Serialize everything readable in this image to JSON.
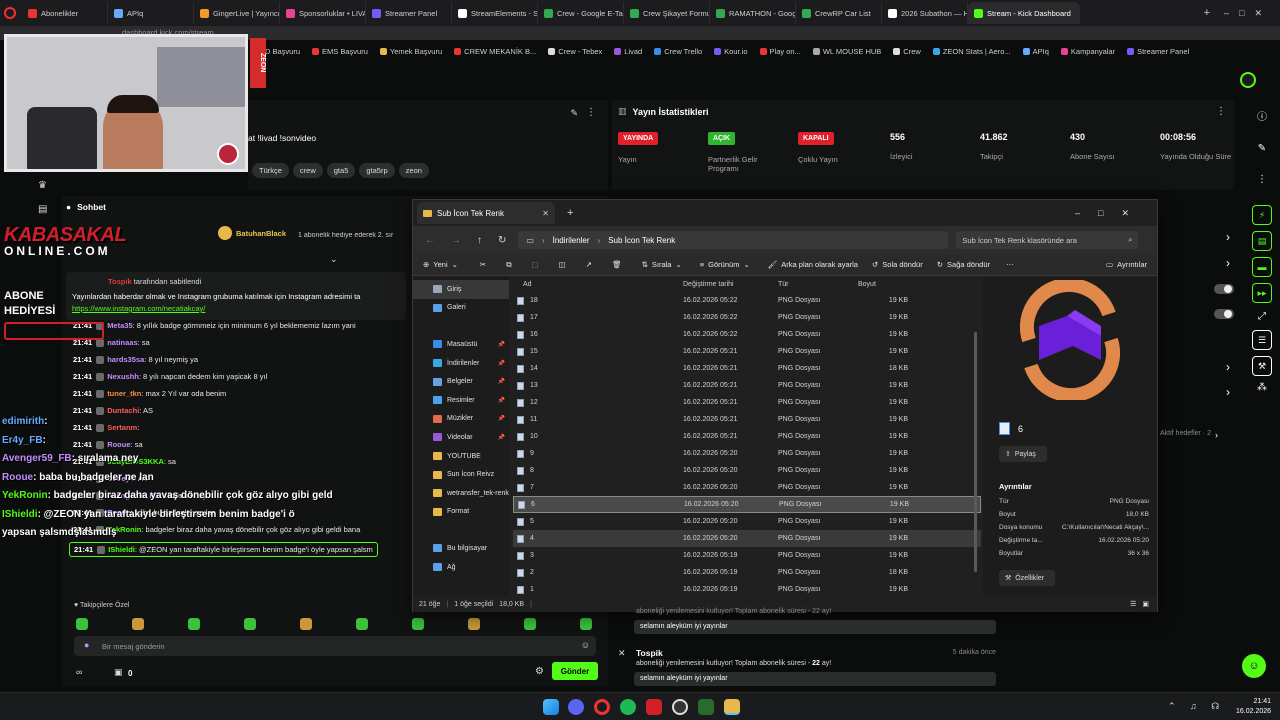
{
  "browser": {
    "tabs": [
      {
        "label": "Abonelikler",
        "color": "#e33"
      },
      {
        "label": "APIq",
        "color": "#66aaff"
      },
      {
        "label": "GingerLive | Yayıncı",
        "color": "#f59b2b"
      },
      {
        "label": "Sponsorluklar • LIVA",
        "color": "#e84393"
      },
      {
        "label": "Streamer Panel",
        "color": "#7a5af5"
      },
      {
        "label": "StreamElements - S",
        "color": "#ffffff"
      },
      {
        "label": "Crew - Google E-Ta",
        "color": "#34a853"
      },
      {
        "label": "Crew Şikayet Formu",
        "color": "#34a853"
      },
      {
        "label": "RAMATHON - Goog",
        "color": "#34a853"
      },
      {
        "label": "CrewRP Car List",
        "color": "#34a853"
      },
      {
        "label": "2026 Subathon — H",
        "color": "#ffffff"
      },
      {
        "label": "Stream - Kick Dashboard",
        "color": "#53fc18"
      }
    ],
    "address": "dashboard.kick.com/stream",
    "bookmarks": [
      "PD Başvuru",
      "EMS Başvuru",
      "Yemek Başvuru",
      "CREW MEKANİK B...",
      "Crew - Tebex",
      "Livad",
      "Crew Trello",
      "Kour.io",
      "Play on...",
      "WL MOUSE HUB",
      "Crew",
      "ZEON Stats | Aero...",
      "APIq",
      "Kampanyalar",
      "Streamer Panel"
    ]
  },
  "stream": {
    "title_partial": "at !livad !sonvideo",
    "tags": [
      "Türkçe",
      "crew",
      "gta5",
      "gta5rp",
      "zeon"
    ],
    "zeon_badge": "ZEON"
  },
  "stats": {
    "heading": "Yayın İstatistikleri",
    "items": [
      {
        "badge": "YAYINDA",
        "badge_color": "#e0202a",
        "label": "Yayın"
      },
      {
        "badge": "AÇIK",
        "badge_color": "#2fb52f",
        "label": "Partnerlik Gelir Programı"
      },
      {
        "badge": "KAPALI",
        "badge_color": "#e0202a",
        "label": "Çoklu Yayın"
      },
      {
        "value": "556",
        "label": "İzleyici"
      },
      {
        "value": "41.862",
        "label": "Takipçi"
      },
      {
        "value": "430",
        "label": "Abone Sayısı"
      },
      {
        "value": "00:08:56",
        "label": "Yayında Olduğu Süre"
      }
    ]
  },
  "chat": {
    "heading": "Sohbet",
    "hype": {
      "user": "BatuhanBlack",
      "text": "1 abonelik hediye ederek 2. sır"
    },
    "pinned_by": "tarafından sabitlendi",
    "pinned_user": "Tospik",
    "pinned_text": "Yayınlardan haberdar olmak ve Instagram grubuma katılmak için Instagram adresimi ta",
    "pinned_link": "https://www.instagram.com/necatiakcay/",
    "messages": [
      {
        "time": "21:41",
        "user": "Meta35",
        "color": "#c58cff",
        "text": ": 8 yıllık badge görmmeiz için minimum 6 yıl beklememiz lazım yani"
      },
      {
        "time": "21:41",
        "user": "natinaas",
        "color": "#c58cff",
        "text": ": sa"
      },
      {
        "time": "21:41",
        "user": "hards35sa",
        "color": "#c58cff",
        "text": ": 8 yıl neymiş ya"
      },
      {
        "time": "21:41",
        "user": "Nexushh",
        "color": "#c58cff",
        "text": ": 8 yılı napcan dedem kim yaşicak 8 yıl"
      },
      {
        "time": "21:41",
        "user": "tuner_tkn",
        "color": "#ff8a3d",
        "text": ": max 2 Yıl var oda benim"
      },
      {
        "time": "21:41",
        "user": "Duntachi",
        "color": "#ff5a5a",
        "text": ": AS"
      },
      {
        "time": "21:41",
        "user": "Sertanm",
        "color": "#ff5a5a",
        "text": ":"
      },
      {
        "time": "21:41",
        "user": "Rooue",
        "color": "#c58cff",
        "text": ": sa"
      },
      {
        "time": "21:41",
        "user": "sCayErDS3KKA",
        "color": "#53fc18",
        "text": ": sa"
      },
      {
        "time": "21:41",
        "user": "Dedeyh",
        "color": "#c58cff",
        "text": ": AS"
      },
      {
        "time": "21:41",
        "user": "Avenger59_FB",
        "color": "#c58cff",
        "text": ": sıralama ney"
      },
      {
        "time": "21:41",
        "user": "Rooue",
        "color": "#c58cff",
        "text": ": baba bu badgeler ne lan"
      },
      {
        "time": "21:41",
        "user": "YekRonin",
        "color": "#53fc18",
        "text": ": badgeler biraz daha yavaş dönebilir çok göz alıyo gibi geldi bana"
      },
      {
        "time": "21:41",
        "user": "IShieldi",
        "color": "#53fc18",
        "text": ": @ZEON yan taraftakiyle birleştirsem benim badge'i öyle yapsan şalsm"
      }
    ],
    "followers_only": "Takipçilere Özel",
    "input_placeholder": "Bir mesaj gönderin",
    "send_label": "Gönder",
    "points": "0"
  },
  "overlay": {
    "brand_line1": "KABASAKAL",
    "brand_line2": "ONLINE.COM",
    "abone": "ABONE",
    "hediyesi": "HEDİYESİ",
    "lines": [
      {
        "user": "edimirith",
        "color": "#66aaff",
        "text": ":"
      },
      {
        "user": "Er4y_FB",
        "color": "#66aaff",
        "text": ":"
      },
      {
        "user": "Avenger59_FB",
        "color": "#c58cff",
        "text": ": sıralama ney"
      },
      {
        "user": "Rooue",
        "color": "#c58cff",
        "text": ": baba bu badgeler ne lan"
      },
      {
        "user": "YekRonin",
        "color": "#53fc18",
        "text": ": badgeler biraz daha yavaş dönebilir çok göz alıyo gibi geld"
      },
      {
        "user": "IShieldi",
        "color": "#53fc18",
        "text": ": @ZEON yan taraftakiyle birleştirsem benim badge'i ö"
      },
      {
        "user": "",
        "color": "#ffffff",
        "text": "yapsan şalsmdşlasmdlş"
      }
    ]
  },
  "explorer": {
    "tab_title": "Sub İcon Tek Renk",
    "breadcrumb": [
      "İndirilenler",
      "Sub İcon Tek Renk"
    ],
    "search_placeholder": "Sub İcon Tek Renk klasöründe ara",
    "toolbar": {
      "new": "Yeni",
      "sort": "Sırala",
      "view": "Görünüm",
      "set_bg": "Arka plan olarak ayarla",
      "rotate_left": "Sola döndür",
      "rotate_right": "Sağa döndür",
      "details": "Ayrıntılar"
    },
    "columns": [
      "Ad",
      "Değiştirme tarihi",
      "Tür",
      "Boyut"
    ],
    "sidebar": [
      {
        "label": "Giriş",
        "color": "#9aa7b8"
      },
      {
        "label": "Galeri",
        "color": "#5aa0e8"
      },
      {
        "label": "Masaüstü",
        "color": "#3a8ee6"
      },
      {
        "label": "İndirilenler",
        "color": "#3aa6e6"
      },
      {
        "label": "Belgeler",
        "color": "#6a9fe0"
      },
      {
        "label": "Resimler",
        "color": "#4aa3e8"
      },
      {
        "label": "Müzikler",
        "color": "#e06a4a"
      },
      {
        "label": "Videolar",
        "color": "#9b59d6"
      },
      {
        "label": "YOUTUBE",
        "color": "#e8b84a"
      },
      {
        "label": "Sun İcon Reivz",
        "color": "#e8b84a"
      },
      {
        "label": "wetransfer_tek-renk",
        "color": "#e8b84a"
      },
      {
        "label": "Format",
        "color": "#e8b84a"
      },
      {
        "label": "Bu bilgisayar",
        "color": "#5aa0e8"
      },
      {
        "label": "Ağ",
        "color": "#5aa0e8"
      }
    ],
    "files": [
      {
        "name": "18",
        "date": "16.02.2026 05:22",
        "type": "PNG Dosyası",
        "size": "19 KB"
      },
      {
        "name": "17",
        "date": "16.02.2026 05:22",
        "type": "PNG Dosyası",
        "size": "19 KB"
      },
      {
        "name": "16",
        "date": "16.02.2026 05:22",
        "type": "PNG Dosyası",
        "size": "19 KB"
      },
      {
        "name": "15",
        "date": "16.02.2026 05:21",
        "type": "PNG Dosyası",
        "size": "19 KB"
      },
      {
        "name": "14",
        "date": "16.02.2026 05:21",
        "type": "PNG Dosyası",
        "size": "18 KB"
      },
      {
        "name": "13",
        "date": "16.02.2026 05:21",
        "type": "PNG Dosyası",
        "size": "19 KB"
      },
      {
        "name": "12",
        "date": "16.02.2026 05:21",
        "type": "PNG Dosyası",
        "size": "19 KB"
      },
      {
        "name": "11",
        "date": "16.02.2026 05:21",
        "type": "PNG Dosyası",
        "size": "19 KB"
      },
      {
        "name": "10",
        "date": "16.02.2026 05:21",
        "type": "PNG Dosyası",
        "size": "19 KB"
      },
      {
        "name": "9",
        "date": "16.02.2026 05:20",
        "type": "PNG Dosyası",
        "size": "19 KB"
      },
      {
        "name": "8",
        "date": "16.02.2026 05:20",
        "type": "PNG Dosyası",
        "size": "19 KB"
      },
      {
        "name": "7",
        "date": "16.02.2026 05:20",
        "type": "PNG Dosyası",
        "size": "19 KB"
      },
      {
        "name": "6",
        "date": "16.02.2026 05:20",
        "type": "PNG Dosyası",
        "size": "19 KB",
        "selected": true
      },
      {
        "name": "5",
        "date": "16.02.2026 05:20",
        "type": "PNG Dosyası",
        "size": "19 KB"
      },
      {
        "name": "4",
        "date": "16.02.2026 05:20",
        "type": "PNG Dosyası",
        "size": "19 KB",
        "hover": true
      },
      {
        "name": "3",
        "date": "16.02.2026 05:19",
        "type": "PNG Dosyası",
        "size": "19 KB"
      },
      {
        "name": "2",
        "date": "16.02.2026 05:19",
        "type": "PNG Dosyası",
        "size": "18 KB"
      },
      {
        "name": "1",
        "date": "16.02.2026 05:19",
        "type": "PNG Dosyası",
        "size": "19 KB"
      }
    ],
    "preview": {
      "name": "6",
      "share": "Paylaş",
      "details_heading": "Ayrıntılar",
      "details": [
        {
          "k": "Tür",
          "v": "PNG Dosyası"
        },
        {
          "k": "Boyut",
          "v": "18,0 KB"
        },
        {
          "k": "Dosya konumu",
          "v": "C:\\Kullanıcılar\\Necati Akçay\\..."
        },
        {
          "k": "Değiştirme ta...",
          "v": "16.02.2026 05:20"
        },
        {
          "k": "Boyutlar",
          "v": "36 x 36"
        }
      ],
      "properties": "Özellikler"
    },
    "status": {
      "count": "21 öğe",
      "selected": "1 öğe seçildi",
      "size": "18,0 KB"
    }
  },
  "activity": {
    "aktif_hedefler": "Aktif hedefler · 2",
    "partial_text": "aboneliği yenilemesini kutluyor! Toplam abonelik süresi - 22 ay!",
    "partial_msg": "selamın aleyküm iyi yayınlar",
    "user": "Tospik",
    "time_ago": "5 dakika önce",
    "text_prefix": "aboneliği yenilemesini kutluyor! Toplam abonelik süresi - ",
    "months": "22",
    "text_suffix": " ay!",
    "msg": "selamın aleyküm iyi yayınlar"
  },
  "taskbar": {
    "time": "21:41",
    "date": "16.02.2026"
  }
}
